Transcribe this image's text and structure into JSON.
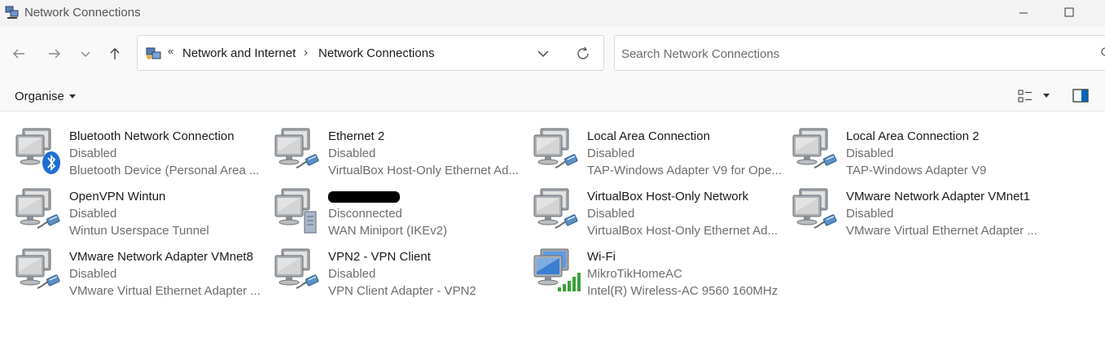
{
  "window": {
    "title": "Network Connections"
  },
  "address_bar": {
    "overflow": "«",
    "crumbs": [
      "Network and Internet",
      "Network Connections"
    ],
    "separator": "›"
  },
  "search": {
    "placeholder": "Search Network Connections"
  },
  "toolbar": {
    "organise_label": "Organise"
  },
  "connections": [
    {
      "name": "Bluetooth Network Connection",
      "status": "Disabled",
      "device": "Bluetooth Device (Personal Area ...",
      "overlay": "bluetooth"
    },
    {
      "name": "Ethernet 2",
      "status": "Disabled",
      "device": "VirtualBox Host-Only Ethernet Ad...",
      "overlay": "cable"
    },
    {
      "name": "Local Area Connection",
      "status": "Disabled",
      "device": "TAP-Windows Adapter V9 for Ope...",
      "overlay": "cable"
    },
    {
      "name": "Local Area Connection 2",
      "status": "Disabled",
      "device": "TAP-Windows Adapter V9",
      "overlay": "cable"
    },
    {
      "name": "OpenVPN Wintun",
      "status": "Disabled",
      "device": "Wintun Userspace Tunnel",
      "overlay": "cable"
    },
    {
      "name": "",
      "status": "Disconnected",
      "device": "WAN Miniport (IKEv2)",
      "overlay": "server",
      "redacted": true
    },
    {
      "name": "VirtualBox Host-Only Network",
      "status": "Disabled",
      "device": "VirtualBox Host-Only Ethernet Ad...",
      "overlay": "cable"
    },
    {
      "name": "VMware Network Adapter VMnet1",
      "status": "Disabled",
      "device": "VMware Virtual Ethernet Adapter ...",
      "overlay": "cable"
    },
    {
      "name": "VMware Network Adapter VMnet8",
      "status": "Disabled",
      "device": "VMware Virtual Ethernet Adapter ...",
      "overlay": "cable"
    },
    {
      "name": "VPN2 - VPN Client",
      "status": "Disabled",
      "device": "VPN Client Adapter - VPN2",
      "overlay": "cable"
    },
    {
      "name": "Wi-Fi",
      "status": "MikroTikHomeAC",
      "device": "Intel(R) Wireless-AC 9560 160MHz",
      "overlay": "signal",
      "active": true
    }
  ],
  "colors": {
    "accent": "#0067c0",
    "bluetooth": "#1f6fd1",
    "signal": "#3aa13a"
  }
}
